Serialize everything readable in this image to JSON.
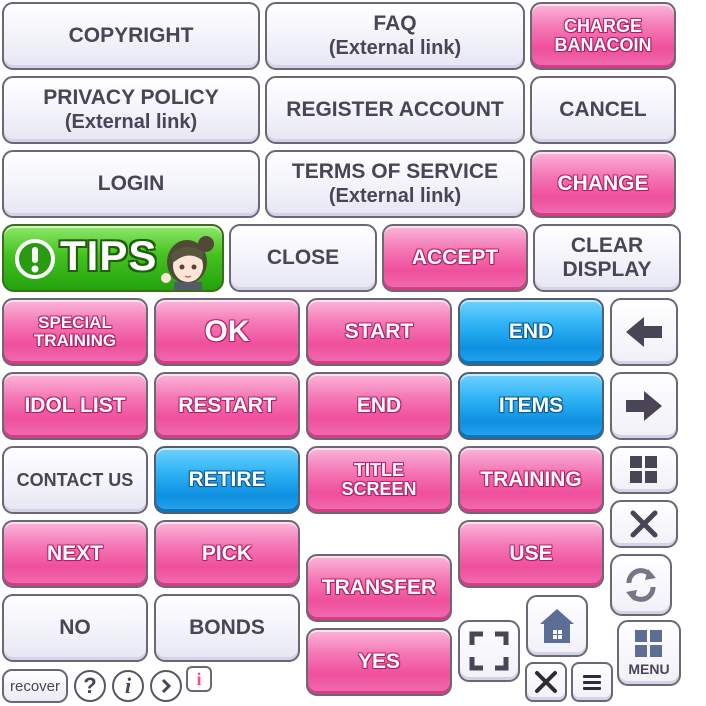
{
  "buttons": {
    "copyright": "COPYRIGHT",
    "faq": "FAQ",
    "external_link": "(External link)",
    "charge_line1": "CHARGE",
    "charge_line2": "BANACOIN",
    "privacy_policy": "PRIVACY POLICY",
    "register_account": "REGISTER ACCOUNT",
    "cancel": "CANCEL",
    "login": "LOGIN",
    "terms_of_service": "TERMS OF SERVICE",
    "change": "CHANGE",
    "tips": "TIPS",
    "close": "CLOSE",
    "accept": "ACCEPT",
    "clear_line1": "CLEAR",
    "clear_line2": "DISPLAY",
    "special_line1": "SPECIAL",
    "special_line2": "TRAINING",
    "ok": "OK",
    "start": "START",
    "end": "END",
    "idol_list": "IDOL LIST",
    "restart": "RESTART",
    "items": "ITEMS",
    "contact_us": "CONTACT US",
    "retire": "RETIRE",
    "title_line1": "TITLE",
    "title_line2": "SCREEN",
    "training": "TRAINING",
    "next": "NEXT",
    "pick": "PICK",
    "use": "USE",
    "transfer": "TRANSFER",
    "no": "NO",
    "bonds": "BONDS",
    "yes": "YES",
    "menu": "MENU",
    "recover": "recover"
  },
  "icons": {
    "question": "?",
    "info": "i",
    "info_box": "i"
  },
  "colors": {
    "pink": "#ef4f9c",
    "blue": "#1a9be6",
    "green": "#35b214",
    "white_button": "#f3f3fa",
    "border": "#6c6675"
  }
}
